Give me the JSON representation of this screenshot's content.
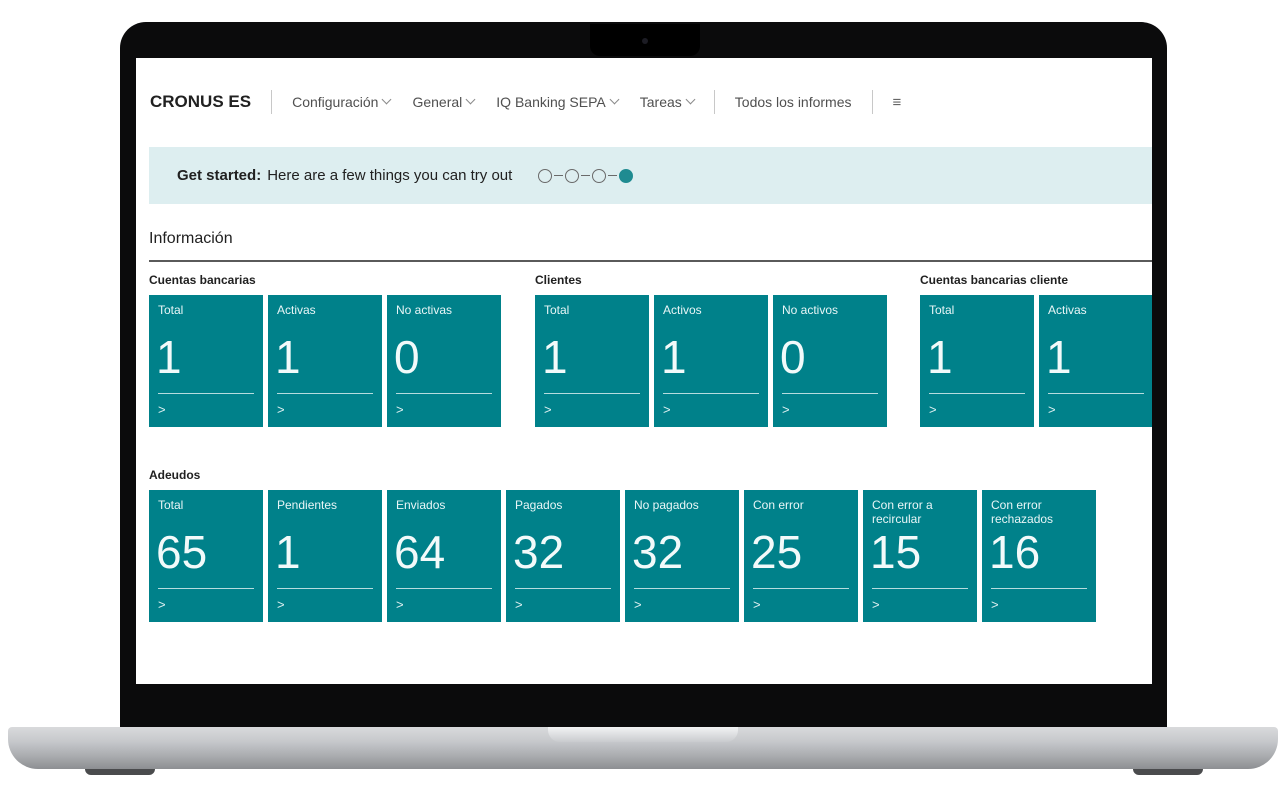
{
  "nav": {
    "company": "CRONUS ES",
    "menus": [
      {
        "label": "Configuración"
      },
      {
        "label": "General"
      },
      {
        "label": "IQ Banking SEPA"
      },
      {
        "label": "Tareas"
      }
    ],
    "reports": "Todos los informes",
    "more_icon": "hamburger-icon"
  },
  "banner": {
    "bold": "Get started:",
    "text": "Here are a few things you can try out",
    "steps_completed": 3,
    "steps_total": 4,
    "accent": "#1f8b91",
    "background": "#ddeef0"
  },
  "section": {
    "title": "Información"
  },
  "groups": {
    "bank_accounts": {
      "title": "Cuentas bancarias",
      "tiles": [
        {
          "label": "Total",
          "value": "1"
        },
        {
          "label": "Activas",
          "value": "1"
        },
        {
          "label": "No activas",
          "value": "0"
        }
      ]
    },
    "customers": {
      "title": "Clientes",
      "tiles": [
        {
          "label": "Total",
          "value": "1"
        },
        {
          "label": "Activos",
          "value": "1"
        },
        {
          "label": "No activos",
          "value": "0"
        }
      ]
    },
    "customer_bank_accounts": {
      "title": "Cuentas bancarias cliente",
      "tiles": [
        {
          "label": "Total",
          "value": "1"
        },
        {
          "label": "Activas",
          "value": "1"
        }
      ]
    },
    "direct_debits": {
      "title": "Adeudos",
      "tiles": [
        {
          "label": "Total",
          "value": "65"
        },
        {
          "label": "Pendientes",
          "value": "1"
        },
        {
          "label": "Enviados",
          "value": "64"
        },
        {
          "label": "Pagados",
          "value": "32"
        },
        {
          "label": "No pagados",
          "value": "32"
        },
        {
          "label": "Con error",
          "value": "25"
        },
        {
          "label": "Con error a recircular",
          "value": "15"
        },
        {
          "label": "Con error rechazados",
          "value": "16"
        }
      ]
    }
  },
  "tile_arrow": ">",
  "colors": {
    "tile": "#00818a",
    "frame": "#0b0b0c"
  }
}
